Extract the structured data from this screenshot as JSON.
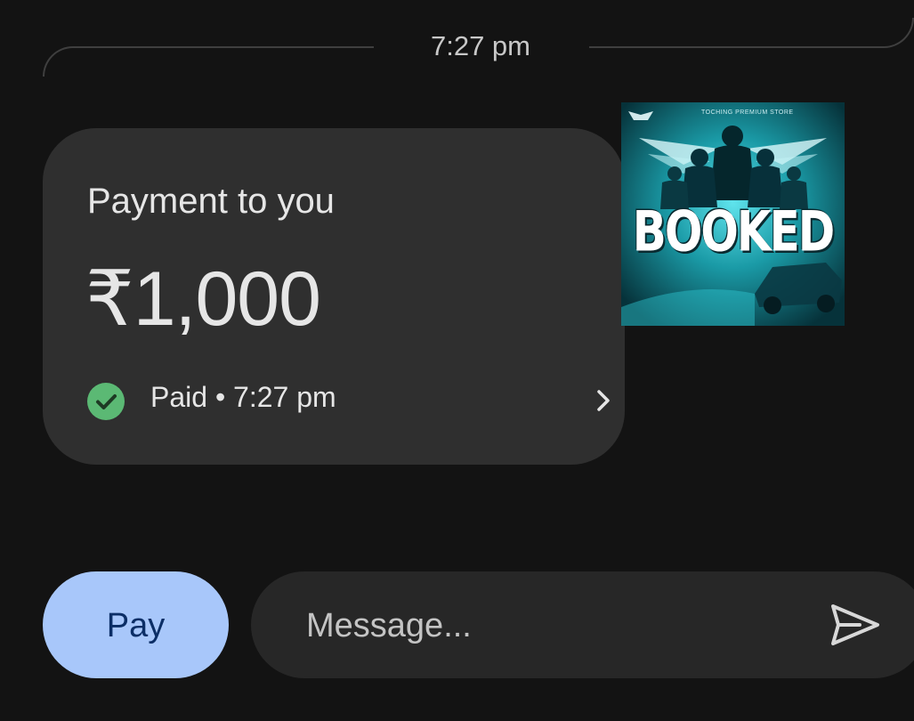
{
  "chat": {
    "timestamp": "7:27 pm"
  },
  "payment_card": {
    "title": "Payment to you",
    "amount": "₹1,000",
    "status": "Paid • 7:27 pm",
    "status_icon": "check-circle-icon",
    "status_color": "#5bb974",
    "open_icon": "chevron-right-icon"
  },
  "image_message": {
    "headline": "BOOKED",
    "store_text": "TOCHING PREMIUM STORE"
  },
  "composer": {
    "pay_label": "Pay",
    "message_placeholder": "Message...",
    "send_icon": "send-icon",
    "accent": "#a8c7fa"
  }
}
